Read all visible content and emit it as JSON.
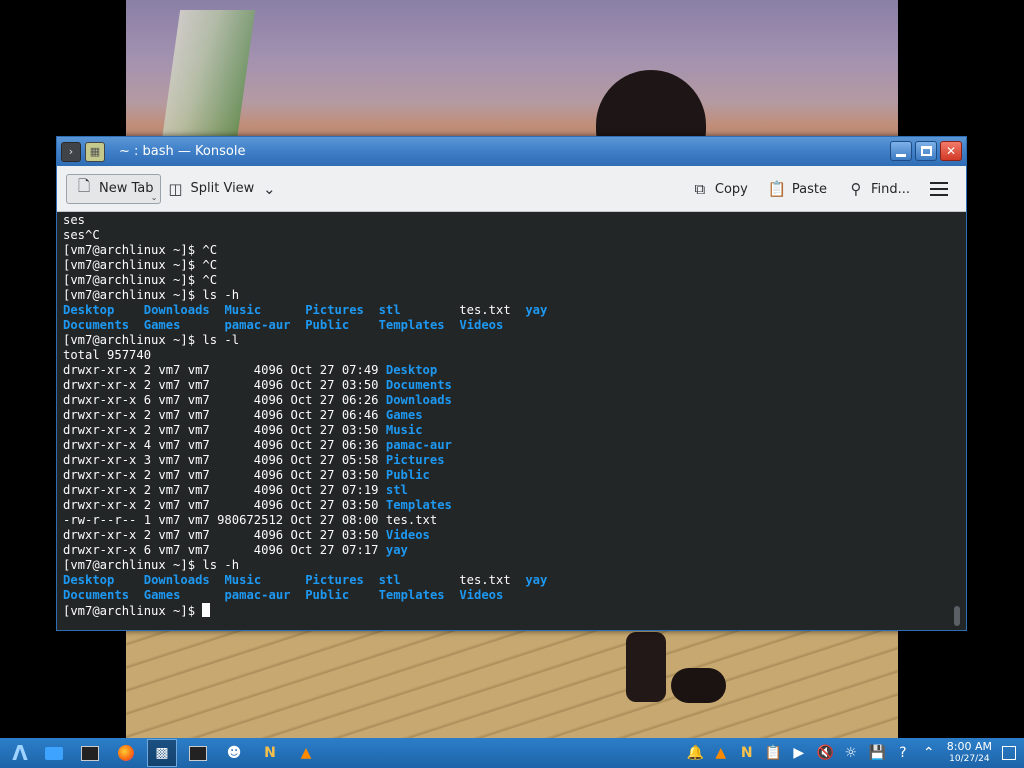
{
  "window": {
    "title": "~ : bash — Konsole"
  },
  "toolbar": {
    "new_tab": "New Tab",
    "split_view": "Split View",
    "copy": "Copy",
    "paste": "Paste",
    "find": "Find..."
  },
  "terminal": {
    "lines": [
      [
        {
          "t": "ses"
        }
      ],
      [
        {
          "t": "ses^C"
        }
      ],
      [
        {
          "t": "[vm7@archlinux ~]$ ^C"
        }
      ],
      [
        {
          "t": "[vm7@archlinux ~]$ ^C"
        }
      ],
      [
        {
          "t": "[vm7@archlinux ~]$ ^C"
        }
      ],
      [
        {
          "t": "[vm7@archlinux ~]$ ls -h"
        }
      ],
      [
        {
          "t": "Desktop",
          "c": "dir"
        },
        {
          "t": "    "
        },
        {
          "t": "Downloads",
          "c": "dir"
        },
        {
          "t": "  "
        },
        {
          "t": "Music",
          "c": "dir"
        },
        {
          "t": "      "
        },
        {
          "t": "Pictures",
          "c": "dir"
        },
        {
          "t": "  "
        },
        {
          "t": "stl",
          "c": "dir"
        },
        {
          "t": "        tes.txt  "
        },
        {
          "t": "yay",
          "c": "dir"
        }
      ],
      [
        {
          "t": "Documents",
          "c": "dir"
        },
        {
          "t": "  "
        },
        {
          "t": "Games",
          "c": "dir"
        },
        {
          "t": "      "
        },
        {
          "t": "pamac-aur",
          "c": "dir"
        },
        {
          "t": "  "
        },
        {
          "t": "Public",
          "c": "dir"
        },
        {
          "t": "    "
        },
        {
          "t": "Templates",
          "c": "dir"
        },
        {
          "t": "  "
        },
        {
          "t": "Videos",
          "c": "dir"
        }
      ],
      [
        {
          "t": "[vm7@archlinux ~]$ ls -l"
        }
      ],
      [
        {
          "t": "total 957740"
        }
      ],
      [
        {
          "t": "drwxr-xr-x 2 vm7 vm7      4096 Oct 27 07:49 "
        },
        {
          "t": "Desktop",
          "c": "dir"
        }
      ],
      [
        {
          "t": "drwxr-xr-x 2 vm7 vm7      4096 Oct 27 03:50 "
        },
        {
          "t": "Documents",
          "c": "dir"
        }
      ],
      [
        {
          "t": "drwxr-xr-x 6 vm7 vm7      4096 Oct 27 06:26 "
        },
        {
          "t": "Downloads",
          "c": "dir"
        }
      ],
      [
        {
          "t": "drwxr-xr-x 2 vm7 vm7      4096 Oct 27 06:46 "
        },
        {
          "t": "Games",
          "c": "dir"
        }
      ],
      [
        {
          "t": "drwxr-xr-x 2 vm7 vm7      4096 Oct 27 03:50 "
        },
        {
          "t": "Music",
          "c": "dir"
        }
      ],
      [
        {
          "t": "drwxr-xr-x 4 vm7 vm7      4096 Oct 27 06:36 "
        },
        {
          "t": "pamac-aur",
          "c": "dir"
        }
      ],
      [
        {
          "t": "drwxr-xr-x 3 vm7 vm7      4096 Oct 27 05:58 "
        },
        {
          "t": "Pictures",
          "c": "dir"
        }
      ],
      [
        {
          "t": "drwxr-xr-x 2 vm7 vm7      4096 Oct 27 03:50 "
        },
        {
          "t": "Public",
          "c": "dir"
        }
      ],
      [
        {
          "t": "drwxr-xr-x 2 vm7 vm7      4096 Oct 27 07:19 "
        },
        {
          "t": "stl",
          "c": "dir"
        }
      ],
      [
        {
          "t": "drwxr-xr-x 2 vm7 vm7      4096 Oct 27 03:50 "
        },
        {
          "t": "Templates",
          "c": "dir"
        }
      ],
      [
        {
          "t": "-rw-r--r-- 1 vm7 vm7 980672512 Oct 27 08:00 tes.txt"
        }
      ],
      [
        {
          "t": "drwxr-xr-x 2 vm7 vm7      4096 Oct 27 03:50 "
        },
        {
          "t": "Videos",
          "c": "dir"
        }
      ],
      [
        {
          "t": "drwxr-xr-x 6 vm7 vm7      4096 Oct 27 07:17 "
        },
        {
          "t": "yay",
          "c": "dir"
        }
      ],
      [
        {
          "t": "[vm7@archlinux ~]$ ls -h"
        }
      ],
      [
        {
          "t": "Desktop",
          "c": "dir"
        },
        {
          "t": "    "
        },
        {
          "t": "Downloads",
          "c": "dir"
        },
        {
          "t": "  "
        },
        {
          "t": "Music",
          "c": "dir"
        },
        {
          "t": "      "
        },
        {
          "t": "Pictures",
          "c": "dir"
        },
        {
          "t": "  "
        },
        {
          "t": "stl",
          "c": "dir"
        },
        {
          "t": "        tes.txt  "
        },
        {
          "t": "yay",
          "c": "dir"
        }
      ],
      [
        {
          "t": "Documents",
          "c": "dir"
        },
        {
          "t": "  "
        },
        {
          "t": "Games",
          "c": "dir"
        },
        {
          "t": "      "
        },
        {
          "t": "pamac-aur",
          "c": "dir"
        },
        {
          "t": "  "
        },
        {
          "t": "Public",
          "c": "dir"
        },
        {
          "t": "    "
        },
        {
          "t": "Templates",
          "c": "dir"
        },
        {
          "t": "  "
        },
        {
          "t": "Videos",
          "c": "dir"
        }
      ]
    ],
    "prompt": "[vm7@archlinux ~]$ "
  },
  "taskbar": {
    "items": [
      "app-launcher-icon",
      "folder-icon",
      "terminal-icon",
      "firefox-icon",
      "konsole-icon",
      "terminal-alt-icon",
      "alien-icon",
      "ide-icon",
      "vlc-icon"
    ],
    "tray": [
      "notification-bell-icon",
      "vlc-tray-icon",
      "nvim-icon",
      "clipboard-icon",
      "media-player-icon",
      "volume-muted-icon",
      "brightness-icon",
      "save-icon",
      "help-icon",
      "chevron-up-icon"
    ],
    "clock_time": "8:00 AM",
    "clock_date": "10/27/24"
  },
  "colors": {
    "terminal_bg": "#232627",
    "terminal_fg": "#fcfcfc",
    "directory": "#1d99f3",
    "titlebar": "#3f7fc7",
    "taskbar": "#2475bf"
  }
}
